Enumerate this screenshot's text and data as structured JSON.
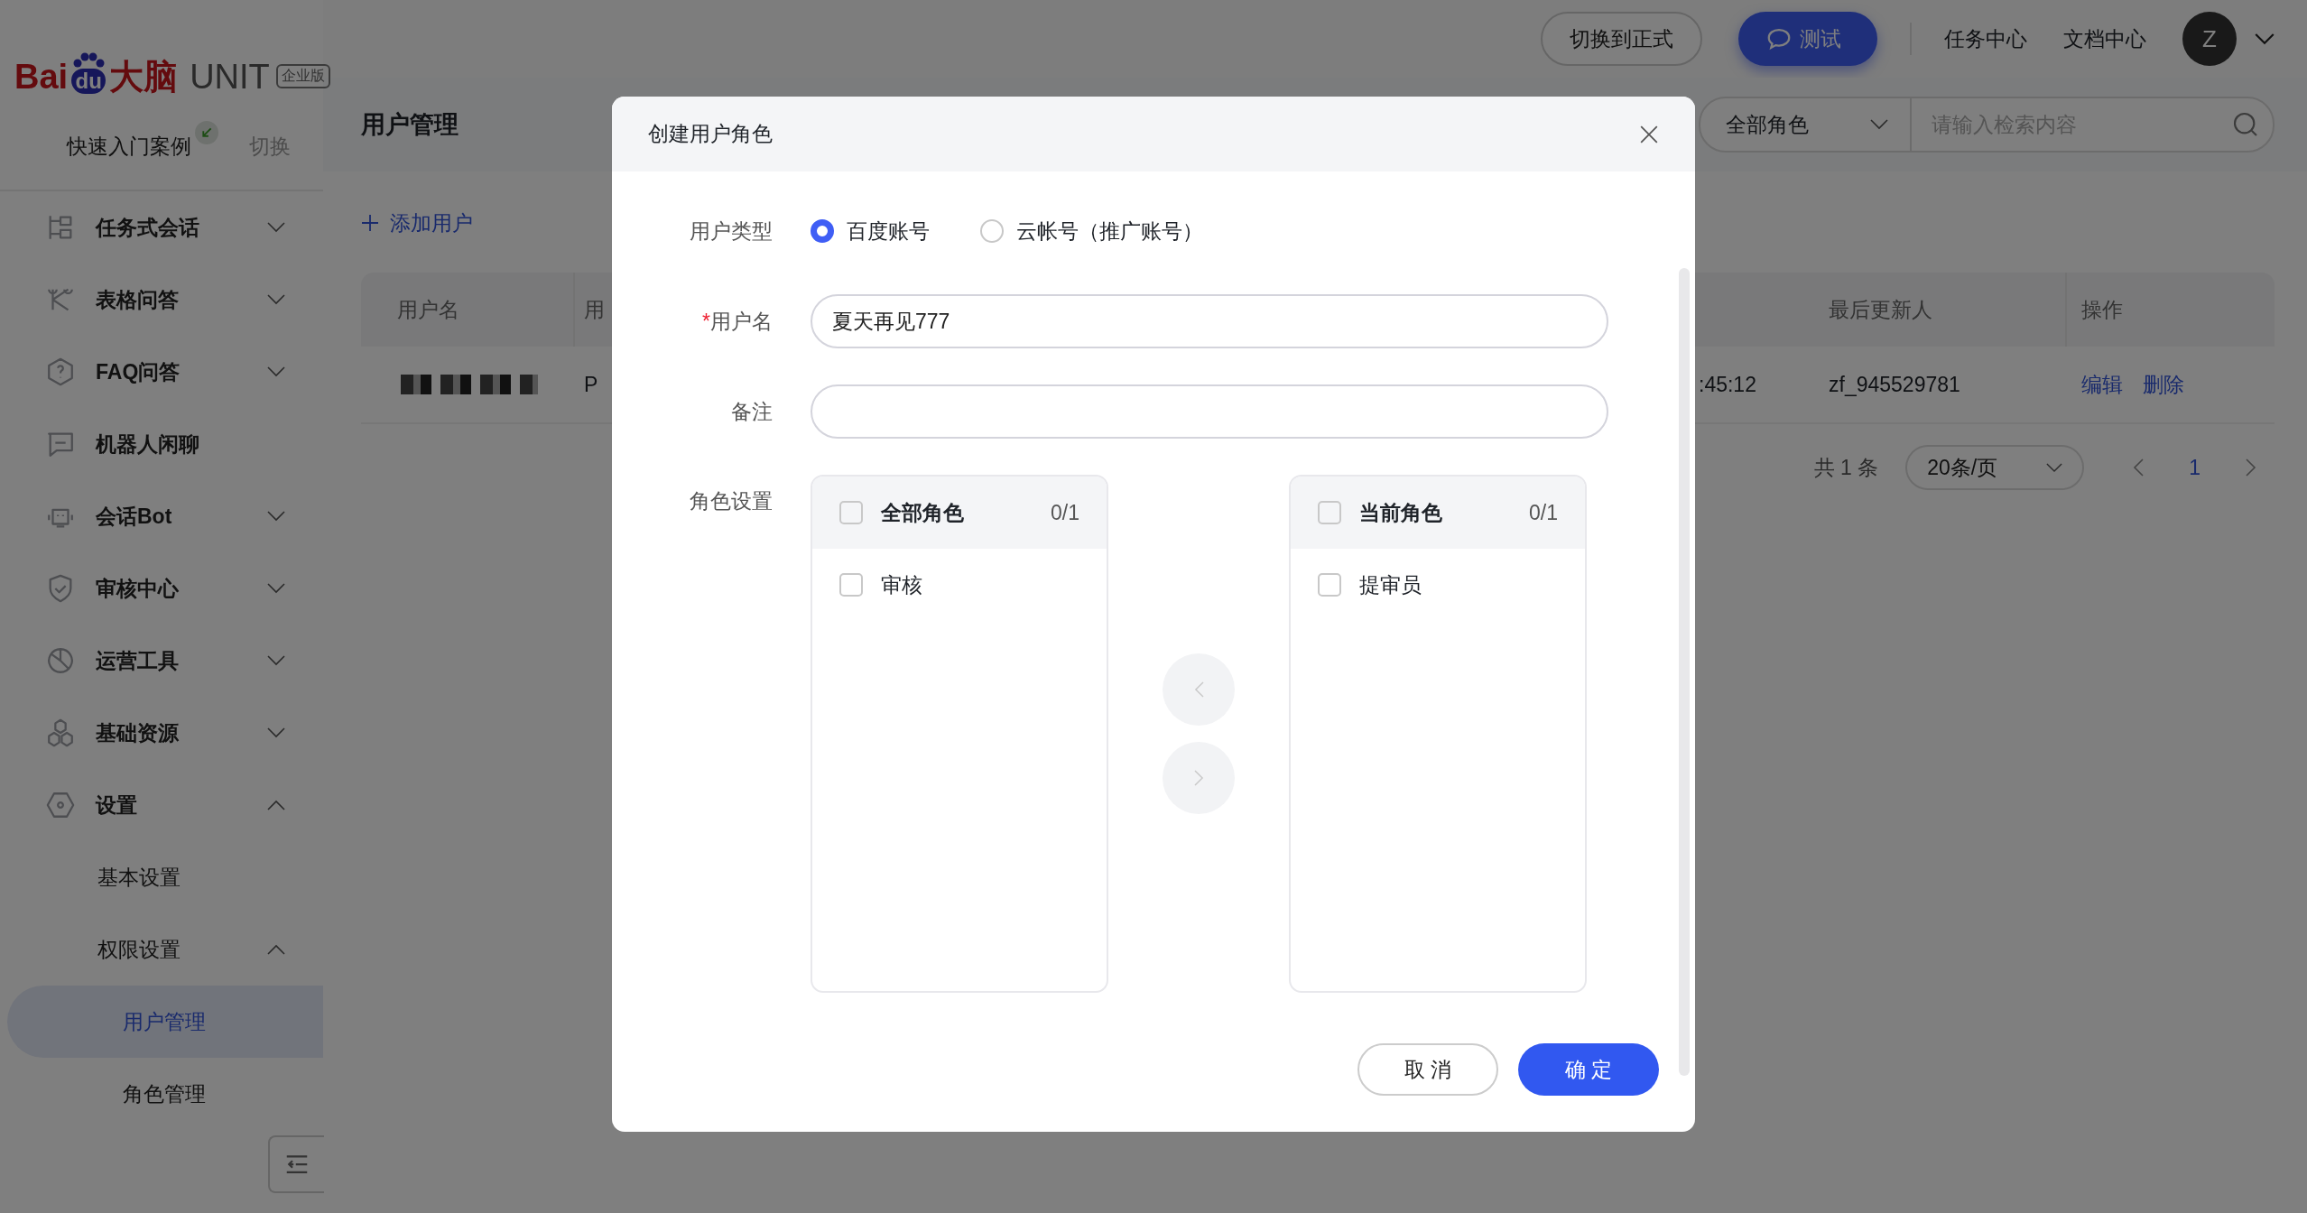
{
  "logo": {
    "brand_red": "Bai",
    "brand_blue": "du",
    "brand_cn": "大脑",
    "product": "UNIT",
    "edition": "企业版"
  },
  "quick_start": {
    "label": "快速入门案例",
    "switch": "切换"
  },
  "sidebar": {
    "items": [
      {
        "label": "任务式会话",
        "expanded": false,
        "selected": false
      },
      {
        "label": "表格问答",
        "expanded": false,
        "selected": false
      },
      {
        "label": "FAQ问答",
        "expanded": false,
        "selected": false
      },
      {
        "label": "机器人闲聊",
        "selected": false
      },
      {
        "label": "会话Bot",
        "expanded": false,
        "selected": false
      },
      {
        "label": "审核中心",
        "expanded": false,
        "selected": false
      },
      {
        "label": "运营工具",
        "expanded": false,
        "selected": false
      },
      {
        "label": "基础资源",
        "expanded": false,
        "selected": false
      },
      {
        "label": "设置",
        "expanded": true,
        "selected": false,
        "children": [
          {
            "label": "基本设置",
            "selected": false
          },
          {
            "label": "权限设置",
            "expanded": true,
            "selected": false,
            "children": [
              {
                "label": "用户管理",
                "selected": true
              },
              {
                "label": "角色管理",
                "selected": false
              }
            ]
          }
        ]
      }
    ]
  },
  "topbar": {
    "switch_button": "切换到正式",
    "test_button": "测试",
    "links": [
      "任务中心",
      "文档中心"
    ],
    "avatar": "Z"
  },
  "page": {
    "title": "用户管理",
    "role_filter": "全部角色",
    "search": {
      "placeholder": "请输入检索内容"
    },
    "add_button": "添加用户"
  },
  "table": {
    "headers": {
      "username": "用户名",
      "column_2": "用",
      "updated_by": "最后更新人",
      "actions": "操作"
    },
    "rows": [
      {
        "column_2": "P",
        "column_3": ":45:12",
        "updated_by": "zf_945529781",
        "actions": [
          "编辑",
          "删除"
        ]
      }
    ]
  },
  "pagination": {
    "total": "共 1 条",
    "page_size": "20条/页",
    "pages": [
      {
        "label": "1",
        "selected": true
      }
    ]
  },
  "modal": {
    "title": "创建用户角色",
    "user_type": {
      "label": "用户类型",
      "options": [
        {
          "label": "百度账号",
          "selected": true
        },
        {
          "label": "云帐号（推广账号）",
          "selected": false
        }
      ]
    },
    "username": {
      "label": "用户名",
      "required_mark": "*",
      "value": "夏天再见777"
    },
    "note": {
      "label": "备注"
    },
    "roles": {
      "label": "角色设置",
      "source": {
        "title": "全部角色",
        "count": "0/1",
        "checked": false,
        "items": [
          {
            "label": "审核",
            "checked": false
          }
        ]
      },
      "target": {
        "title": "当前角色",
        "count": "0/1",
        "checked": false,
        "items": [
          {
            "label": "提审员",
            "checked": false
          }
        ]
      },
      "move_left": {
        "disabled": true
      },
      "move_right": {
        "disabled": true
      }
    },
    "cancel": "取 消",
    "confirm": "确 定"
  }
}
